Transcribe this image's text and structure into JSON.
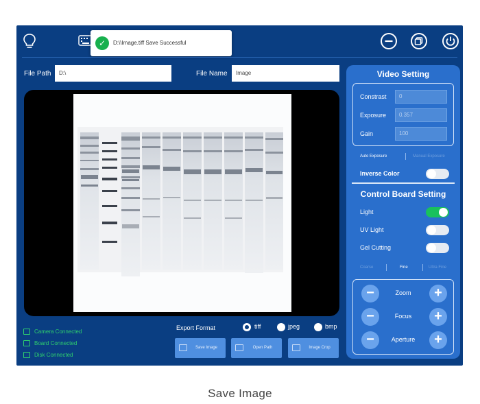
{
  "toast": {
    "message": "D:\\\\Image.tiff Save Successful"
  },
  "top_icons": {
    "bulb": "lightbulb-icon",
    "keyboard": "keyboard-icon",
    "minimize": "minus-circle-icon",
    "restore": "restore-icon",
    "power": "power-icon"
  },
  "file": {
    "path_label": "File Path",
    "path_value": "D:\\",
    "name_label": "File Name",
    "name_value": "Image"
  },
  "status": [
    {
      "icon": "camera-icon",
      "text": "Camera Connected"
    },
    {
      "icon": "board-icon",
      "text": "Board Connected"
    },
    {
      "icon": "disk-icon",
      "text": "Disk Connected"
    }
  ],
  "export": {
    "label": "Export Format",
    "options": [
      {
        "label": "tiff",
        "selected": true
      },
      {
        "label": "jpeg",
        "selected": false
      },
      {
        "label": "bmp",
        "selected": false
      }
    ]
  },
  "actions": [
    {
      "label": "Save Image",
      "icon": "image-icon"
    },
    {
      "label": "Open Path",
      "icon": "folder-icon"
    },
    {
      "label": "Image Crop",
      "icon": "crop-icon"
    }
  ],
  "video": {
    "title": "Video Setting",
    "constrast_label": "Constrast",
    "constrast_value": "0",
    "exposure_label": "Exposure",
    "exposure_value": "0.357",
    "gain_label": "Gain",
    "gain_value": "100",
    "auto_exposure": "Auto Exposure",
    "manual_exposure": "Manual Exposure",
    "inverse_label": "Inverse Color",
    "inverse_on": false
  },
  "control": {
    "title": "Control Board Setting",
    "light_label": "Light",
    "light_on": true,
    "uv_label": "UV Light",
    "uv_on": false,
    "gel_label": "Gel Cutting",
    "gel_on": false,
    "modes": [
      "Coarse",
      "Fine",
      "Ultra Fine"
    ],
    "active_mode": "Fine",
    "zoom_label": "Zoom",
    "focus_label": "Focus",
    "aperture_label": "Aperture"
  },
  "caption": "Save Image",
  "colors": {
    "app_bg": "#0a3e82",
    "panel_bg": "#2a6fcc",
    "accent_green": "#19c15c",
    "status_green": "#2fd06d"
  }
}
